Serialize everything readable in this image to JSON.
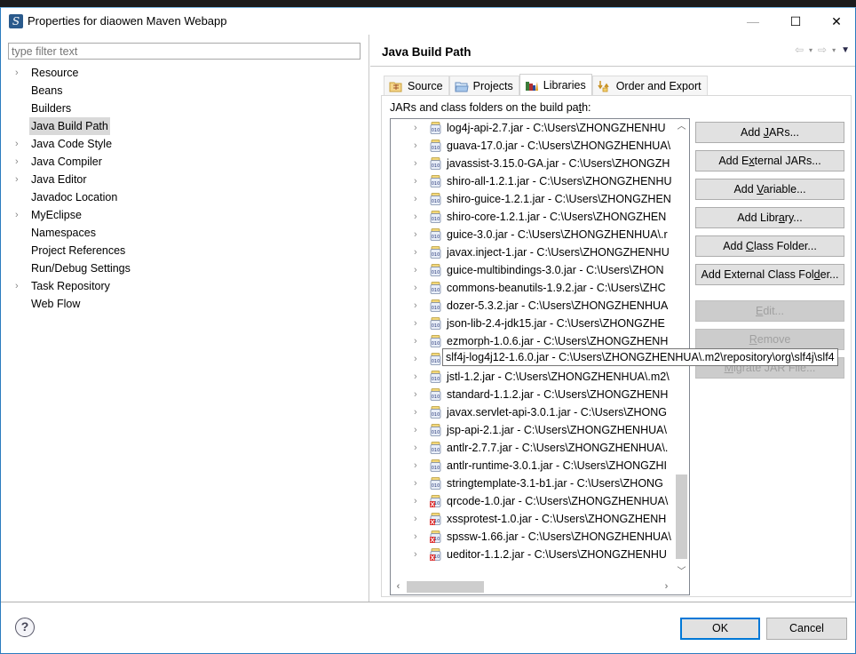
{
  "window": {
    "title": "Properties for diaowen Maven Webapp",
    "controls": {
      "minimize": "—",
      "maximize": "☐",
      "close": "✕"
    }
  },
  "filter": {
    "placeholder": "type filter text",
    "value": ""
  },
  "nav": {
    "items": [
      {
        "label": "Resource",
        "expandable": true,
        "selected": false
      },
      {
        "label": "Beans",
        "expandable": false,
        "selected": false
      },
      {
        "label": "Builders",
        "expandable": false,
        "selected": false
      },
      {
        "label": "Java Build Path",
        "expandable": false,
        "selected": true
      },
      {
        "label": "Java Code Style",
        "expandable": true,
        "selected": false
      },
      {
        "label": "Java Compiler",
        "expandable": true,
        "selected": false
      },
      {
        "label": "Java Editor",
        "expandable": true,
        "selected": false
      },
      {
        "label": "Javadoc Location",
        "expandable": false,
        "selected": false
      },
      {
        "label": "MyEclipse",
        "expandable": true,
        "selected": false
      },
      {
        "label": "Namespaces",
        "expandable": false,
        "selected": false
      },
      {
        "label": "Project References",
        "expandable": false,
        "selected": false
      },
      {
        "label": "Run/Debug Settings",
        "expandable": false,
        "selected": false
      },
      {
        "label": "Task Repository",
        "expandable": true,
        "selected": false
      },
      {
        "label": "Web Flow",
        "expandable": false,
        "selected": false
      }
    ]
  },
  "page": {
    "title": "Java Build Path",
    "history": {
      "back": "⇦",
      "forward": "⇨",
      "dropdown": "▾",
      "menu": "▼"
    }
  },
  "tabs": [
    {
      "label": "Source",
      "icon": "source-folder-icon",
      "active": false
    },
    {
      "label": "Projects",
      "icon": "projects-folder-icon",
      "active": false
    },
    {
      "label": "Libraries",
      "icon": "libraries-icon",
      "active": true
    },
    {
      "label": "Order and Export",
      "icon": "order-export-icon",
      "active": false
    }
  ],
  "libraries": {
    "label_prefix": "JARs and class folders on the build pa",
    "label_mnemonic": "t",
    "label_suffix": "h:",
    "jars": [
      {
        "text": "log4j-api-2.7.jar - C:\\Users\\ZHONGZHENHU",
        "missing": false
      },
      {
        "text": "guava-17.0.jar - C:\\Users\\ZHONGZHENHUA\\",
        "missing": false
      },
      {
        "text": "javassist-3.15.0-GA.jar - C:\\Users\\ZHONGZH",
        "missing": false
      },
      {
        "text": "shiro-all-1.2.1.jar - C:\\Users\\ZHONGZHENHU",
        "missing": false
      },
      {
        "text": "shiro-guice-1.2.1.jar - C:\\Users\\ZHONGZHEN",
        "missing": false
      },
      {
        "text": "shiro-core-1.2.1.jar - C:\\Users\\ZHONGZHEN",
        "missing": false
      },
      {
        "text": "guice-3.0.jar - C:\\Users\\ZHONGZHENHUA\\.r",
        "missing": false
      },
      {
        "text": "javax.inject-1.jar - C:\\Users\\ZHONGZHENHU",
        "missing": false
      },
      {
        "text": "guice-multibindings-3.0.jar - C:\\Users\\ZHON",
        "missing": false
      },
      {
        "text": "commons-beanutils-1.9.2.jar - C:\\Users\\ZHC",
        "missing": false
      },
      {
        "text": "dozer-5.3.2.jar - C:\\Users\\ZHONGZHENHUA",
        "missing": false
      },
      {
        "text": "json-lib-2.4-jdk15.jar - C:\\Users\\ZHONGZHE",
        "missing": false
      },
      {
        "text": "ezmorph-1.0.6.jar - C:\\Users\\ZHONGZHENH",
        "missing": false
      },
      {
        "text": "slf4j-log4j12-1.6.0.jar - C:\\Users\\ZHONGZHENHUA\\.m2\\repository\\org\\slf4j\\slf4",
        "missing": false,
        "focused": true
      },
      {
        "text": "jstl-1.2.jar - C:\\Users\\ZHONGZHENHUA\\.m2\\",
        "missing": false
      },
      {
        "text": "standard-1.1.2.jar - C:\\Users\\ZHONGZHENH",
        "missing": false
      },
      {
        "text": "javax.servlet-api-3.0.1.jar - C:\\Users\\ZHONG",
        "missing": false
      },
      {
        "text": "jsp-api-2.1.jar - C:\\Users\\ZHONGZHENHUA\\",
        "missing": false
      },
      {
        "text": "antlr-2.7.7.jar - C:\\Users\\ZHONGZHENHUA\\.",
        "missing": false
      },
      {
        "text": "antlr-runtime-3.0.1.jar - C:\\Users\\ZHONGZHI",
        "missing": false
      },
      {
        "text": "stringtemplate-3.1-b1.jar - C:\\Users\\ZHONG",
        "missing": false
      },
      {
        "text": "qrcode-1.0.jar - C:\\Users\\ZHONGZHENHUA\\",
        "missing": true
      },
      {
        "text": "xssprotest-1.0.jar - C:\\Users\\ZHONGZHENH",
        "missing": true
      },
      {
        "text": "spssw-1.66.jar - C:\\Users\\ZHONGZHENHUA\\",
        "missing": true
      },
      {
        "text": "ueditor-1.1.2.jar - C:\\Users\\ZHONGZHENHU",
        "missing": true
      }
    ]
  },
  "buttons": {
    "add_jars": {
      "pre": "Add ",
      "mn": "J",
      "post": "ARs...",
      "enabled": true
    },
    "add_external_jars": {
      "pre": "Add E",
      "mn": "x",
      "post": "ternal JARs...",
      "enabled": true
    },
    "add_variable": {
      "pre": "Add ",
      "mn": "V",
      "post": "ariable...",
      "enabled": true
    },
    "add_library": {
      "pre": "Add Libr",
      "mn": "a",
      "post": "ry...",
      "enabled": true
    },
    "add_class_folder": {
      "pre": "Add ",
      "mn": "C",
      "post": "lass Folder...",
      "enabled": true
    },
    "add_external_class_folder": {
      "pre": "Add External Class Fol",
      "mn": "d",
      "post": "er...",
      "enabled": true
    },
    "edit": {
      "pre": "",
      "mn": "E",
      "post": "dit...",
      "enabled": false
    },
    "remove": {
      "pre": "",
      "mn": "R",
      "post": "emove",
      "enabled": false
    },
    "migrate_jar": {
      "pre": "",
      "mn": "M",
      "post": "igrate JAR File...",
      "enabled": false
    }
  },
  "footer": {
    "help": "?",
    "ok": "OK",
    "cancel": "Cancel"
  }
}
